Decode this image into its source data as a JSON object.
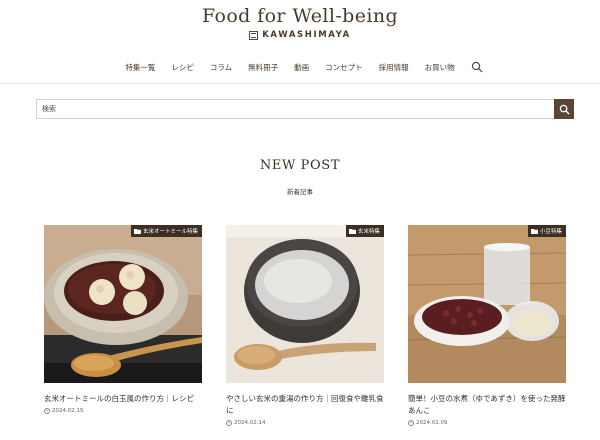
{
  "header": {
    "site_title": "Food for Well-being",
    "brand_name": "KAWASHIMAYA"
  },
  "nav": {
    "items": [
      "特集一覧",
      "レシピ",
      "コラム",
      "無料冊子",
      "動画",
      "コンセプト",
      "採用情報",
      "お買い物"
    ],
    "search_icon": "search-icon"
  },
  "search": {
    "placeholder": "検索",
    "button_icon": "search-icon"
  },
  "new_post": {
    "title": "NEW POST",
    "subtitle": "新着記事"
  },
  "posts": [
    {
      "category": "玄米オートミール特集",
      "title": "玄米オートミールの白玉風の作り方｜レシピ",
      "date": "2024.02.15"
    },
    {
      "category": "玄米特集",
      "title": "やさしい玄米の重湯の作り方｜回復食や離乳食に",
      "date": "2024.02.14"
    },
    {
      "category": "小豆特集",
      "title": "簡単！小豆の水煮（ゆであずき）を使った発酵あんこ",
      "date": "2024.02.09"
    }
  ],
  "colors": {
    "accent": "#5a4634",
    "badge": "#3b2e22",
    "text": "#3b2e22"
  }
}
